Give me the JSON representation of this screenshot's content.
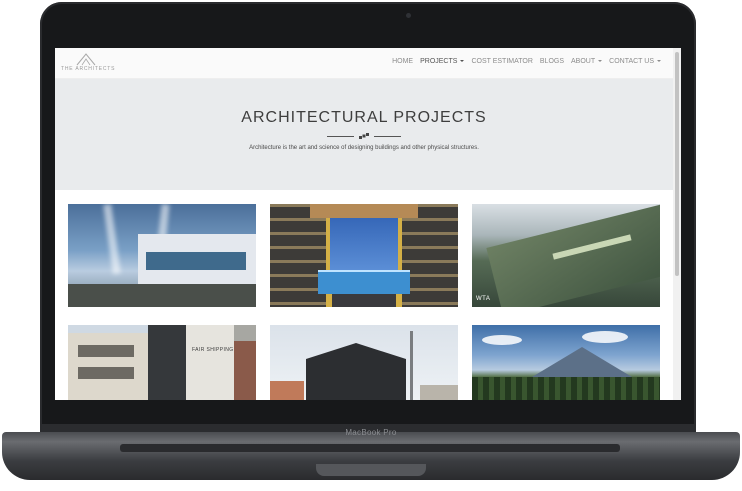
{
  "device": {
    "brand_label": "MacBook Pro"
  },
  "site": {
    "logo_text": "THE ARCHITECTS",
    "nav": {
      "items": [
        {
          "label": "HOME",
          "has_dropdown": false,
          "active": false
        },
        {
          "label": "PROJECTS",
          "has_dropdown": true,
          "active": true
        },
        {
          "label": "COST ESTIMATOR",
          "has_dropdown": false,
          "active": false
        },
        {
          "label": "BLOGS",
          "has_dropdown": false,
          "active": false
        },
        {
          "label": "ABOUT",
          "has_dropdown": true,
          "active": false
        },
        {
          "label": "CONTACT US",
          "has_dropdown": true,
          "active": false
        }
      ]
    },
    "hero": {
      "title": "ARCHITECTURAL PROJECTS",
      "subtitle": "Architecture is the art and science of designing buildings and other physical structures."
    },
    "projects": [
      {
        "image": "modern-building-night"
      },
      {
        "image": "atrium-pool"
      },
      {
        "image": "hillside-terraces",
        "caption": "WTA"
      },
      {
        "image": "fair-shipping-building",
        "caption": "FAIR SHIPPING"
      },
      {
        "image": "dark-timber-building"
      },
      {
        "image": "volcano-landscape"
      }
    ]
  },
  "colors": {
    "hero_bg": "#e9ebed",
    "nav_bg": "#fafafa",
    "laptop_body": "#17181a"
  }
}
